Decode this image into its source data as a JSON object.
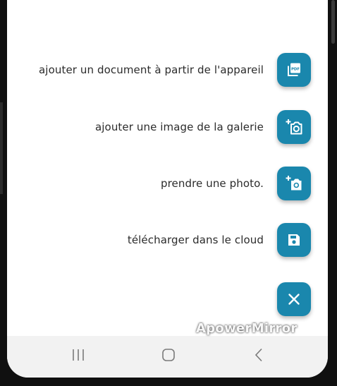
{
  "actions": [
    {
      "label": "ajouter un document à partir de l'appareil",
      "icon": "pdf-file-icon"
    },
    {
      "label": "ajouter une image de la galerie",
      "icon": "add-photo-icon"
    },
    {
      "label": "prendre une photo.",
      "icon": "camera-add-icon"
    },
    {
      "label": "télécharger dans le cloud",
      "icon": "save-disk-icon"
    }
  ],
  "close_button": {
    "icon": "close-icon"
  },
  "navigation": {
    "recent": "recent-apps-icon",
    "home": "home-icon",
    "back": "back-icon"
  },
  "watermark": "ApowerMirror",
  "colors": {
    "accent": "#1a87ad",
    "label_text": "#2b2b2b",
    "nav_bar": "#f2f2f2"
  }
}
